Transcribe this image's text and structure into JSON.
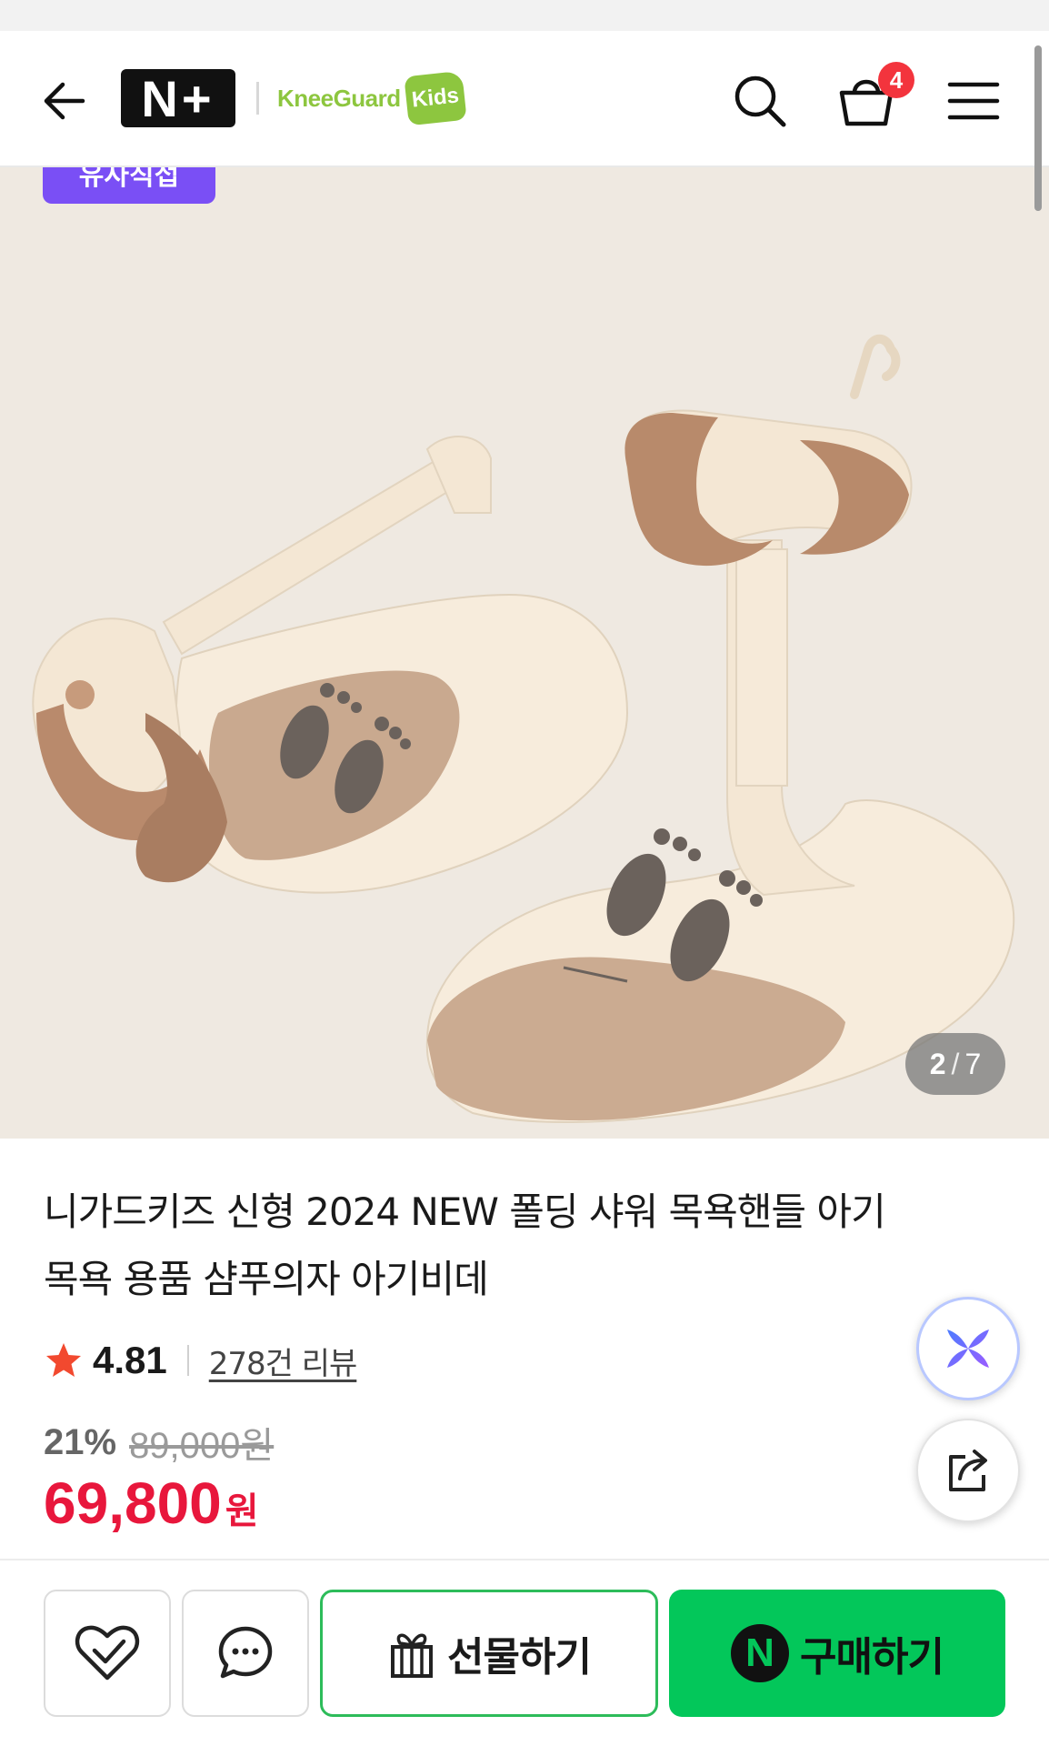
{
  "header": {
    "nplus_logo": "N+",
    "brand_name": "KneeGuard",
    "brand_kids": "Kids",
    "cart_count": "4",
    "icons": [
      "back-arrow-icon",
      "search-icon",
      "cart-icon",
      "menu-icon"
    ]
  },
  "gallery": {
    "promo_tag": "유사직접",
    "current": "2",
    "separator": "/",
    "total": "7"
  },
  "product": {
    "title": "니가드키즈 신형 2024 NEW 폴딩 샤워 목욕핸들 아기목욕 용품 샴푸의자 아기비데",
    "rating": "4.81",
    "review_count": "278건 리뷰",
    "discount_percent": "21%",
    "original_price": "89,000원",
    "price": "69,800",
    "price_unit": "원"
  },
  "bottom_bar": {
    "gift_label": "선물하기",
    "buy_label": "구매하기",
    "buy_logo": "N"
  },
  "colors": {
    "price_red": "#e8173c",
    "naver_green": "#03c75a",
    "promo_purple": "#7a4ff5",
    "badge_red": "#f3343d",
    "brand_green": "#8dc63f"
  }
}
